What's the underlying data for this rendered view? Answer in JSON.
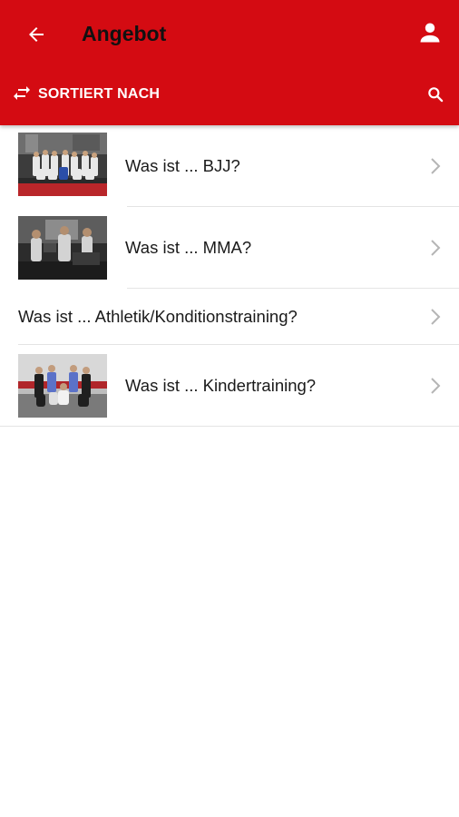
{
  "header": {
    "title": "Angebot",
    "back_icon": "arrow-left-icon",
    "user_icon": "person-icon",
    "sort_label": "SORTIERT NACH",
    "sort_icon": "swap-icon",
    "search_icon": "search-icon",
    "background_color": "#d40b12"
  },
  "items": [
    {
      "label": "Was ist ... BJJ?",
      "has_image": true
    },
    {
      "label": "Was ist ... MMA?",
      "has_image": true
    },
    {
      "label": "Was ist ... Athletik/Konditionstraining?",
      "has_image": false
    },
    {
      "label": "Was ist ... Kindertraining?",
      "has_image": true
    }
  ]
}
